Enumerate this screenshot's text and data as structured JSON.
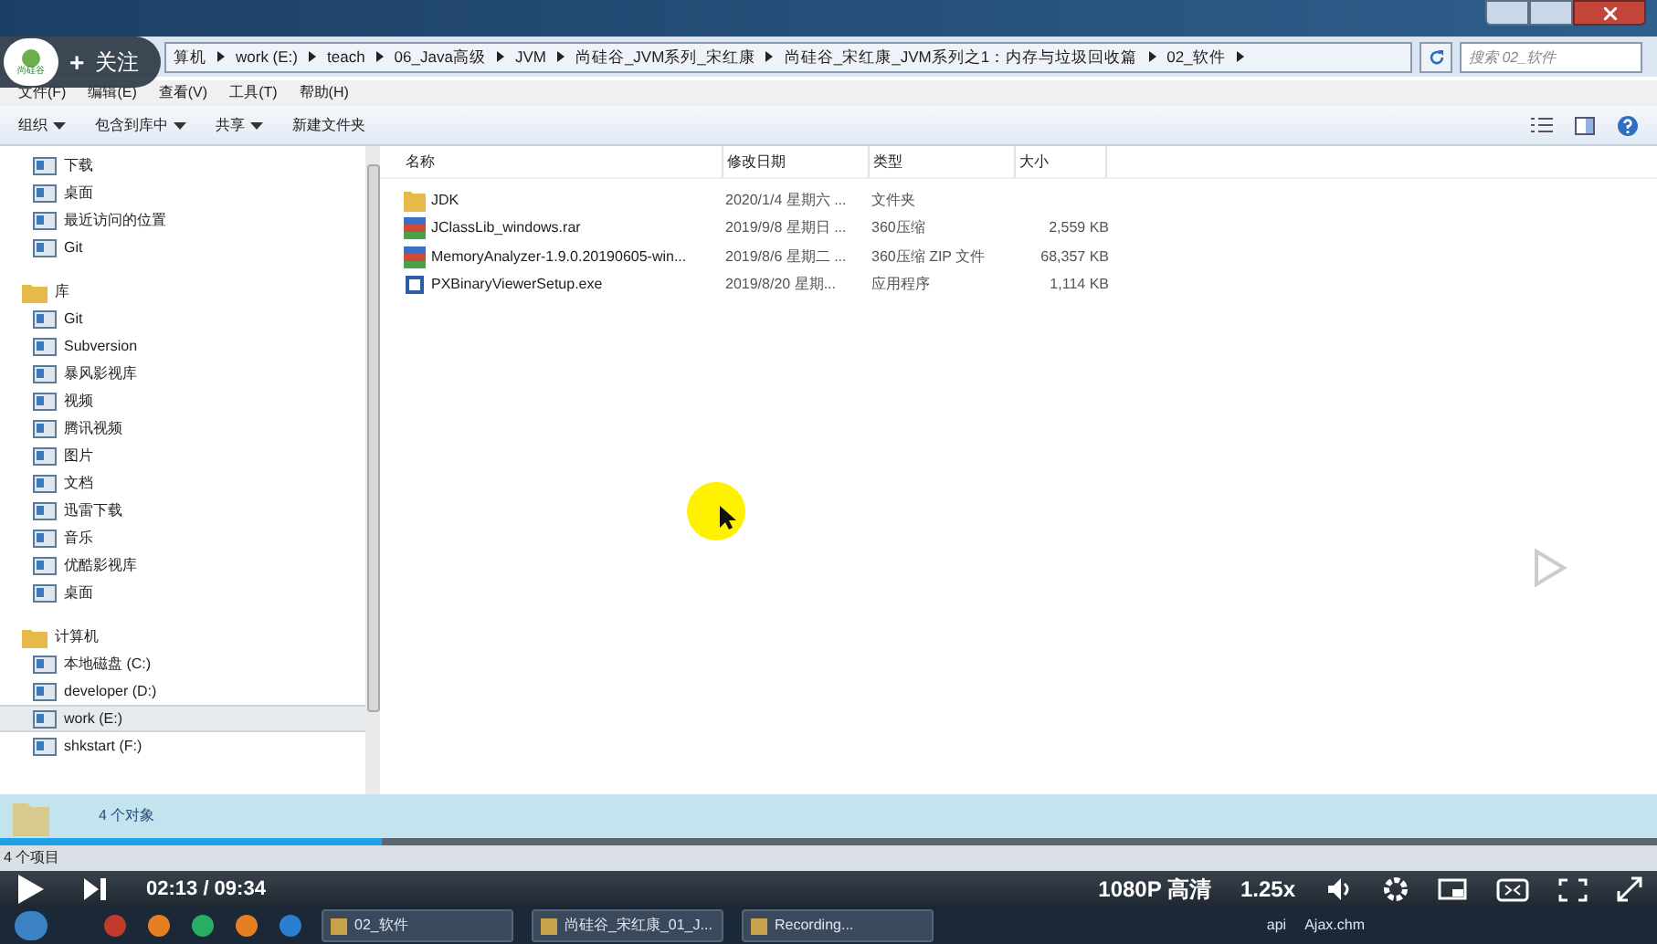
{
  "follow_overlay": {
    "logo_text": "尚硅谷",
    "plus": "+",
    "label": "关注"
  },
  "address": {
    "crumbs": [
      "算机",
      "work (E:)",
      "teach",
      "06_Java高级",
      "JVM",
      "尚硅谷_JVM系列_宋红康",
      "尚硅谷_宋红康_JVM系列之1：内存与垃圾回收篇",
      "02_软件"
    ],
    "search_placeholder": "搜索 02_软件"
  },
  "menu": [
    "文件(F)",
    "编辑(E)",
    "查看(V)",
    "工具(T)",
    "帮助(H)"
  ],
  "toolbar": [
    {
      "label": "组织",
      "dropdown": true
    },
    {
      "label": "包含到库中",
      "dropdown": true
    },
    {
      "label": "共享",
      "dropdown": true
    },
    {
      "label": "新建文件夹",
      "dropdown": false
    }
  ],
  "nav": [
    {
      "children": [
        {
          "label": "下载",
          "selected": false
        },
        {
          "label": "桌面",
          "selected": false
        },
        {
          "label": "最近访问的位置",
          "selected": false
        },
        {
          "label": "Git",
          "selected": false
        }
      ]
    },
    {
      "label": "库",
      "children": [
        {
          "label": "Git",
          "selected": false
        },
        {
          "label": "Subversion",
          "selected": false
        },
        {
          "label": "暴风影视库",
          "selected": false
        },
        {
          "label": "视频",
          "selected": false
        },
        {
          "label": "腾讯视频",
          "selected": false
        },
        {
          "label": "图片",
          "selected": false
        },
        {
          "label": "文档",
          "selected": false
        },
        {
          "label": "迅雷下载",
          "selected": false
        },
        {
          "label": "音乐",
          "selected": false
        },
        {
          "label": "优酷影视库",
          "selected": false
        },
        {
          "label": "桌面",
          "selected": false
        }
      ]
    },
    {
      "label": "计算机",
      "children": [
        {
          "label": "本地磁盘 (C:)",
          "selected": false
        },
        {
          "label": "developer (D:)",
          "selected": false
        },
        {
          "label": "work (E:)",
          "selected": true
        },
        {
          "label": "shkstart (F:)",
          "selected": false
        }
      ]
    }
  ],
  "table": {
    "columns": [
      "名称",
      "修改日期",
      "类型",
      "大小"
    ],
    "rows": [
      {
        "kind": "folder",
        "name": "JDK",
        "date": "2020/1/4 星期六 ...",
        "type": "文件夹",
        "size": ""
      },
      {
        "kind": "archive",
        "name": "JClassLib_windows.rar",
        "date": "2019/9/8 星期日 ...",
        "type": "360压缩",
        "size": "2,559 KB"
      },
      {
        "kind": "archive",
        "name": "MemoryAnalyzer-1.9.0.20190605-win...",
        "date": "2019/8/6 星期二 ...",
        "type": "360压缩 ZIP 文件",
        "size": "68,357 KB"
      },
      {
        "kind": "program",
        "name": "PXBinaryViewerSetup.exe",
        "date": "2019/8/20 星期...",
        "type": "应用程序",
        "size": "1,114 KB"
      }
    ]
  },
  "details_pane": {
    "count": "4 个对象"
  },
  "status_bar": "4 个项目",
  "player": {
    "level": 0.23,
    "time": "02:13 / 09:34",
    "quality": "1080P 高清",
    "speed": "1.25x"
  },
  "taskbar": {
    "items": [
      "02_软件",
      "尚硅谷_宋红康_01_J...",
      "Recording..."
    ],
    "tray": [
      "api",
      "Ajax.chm"
    ]
  }
}
